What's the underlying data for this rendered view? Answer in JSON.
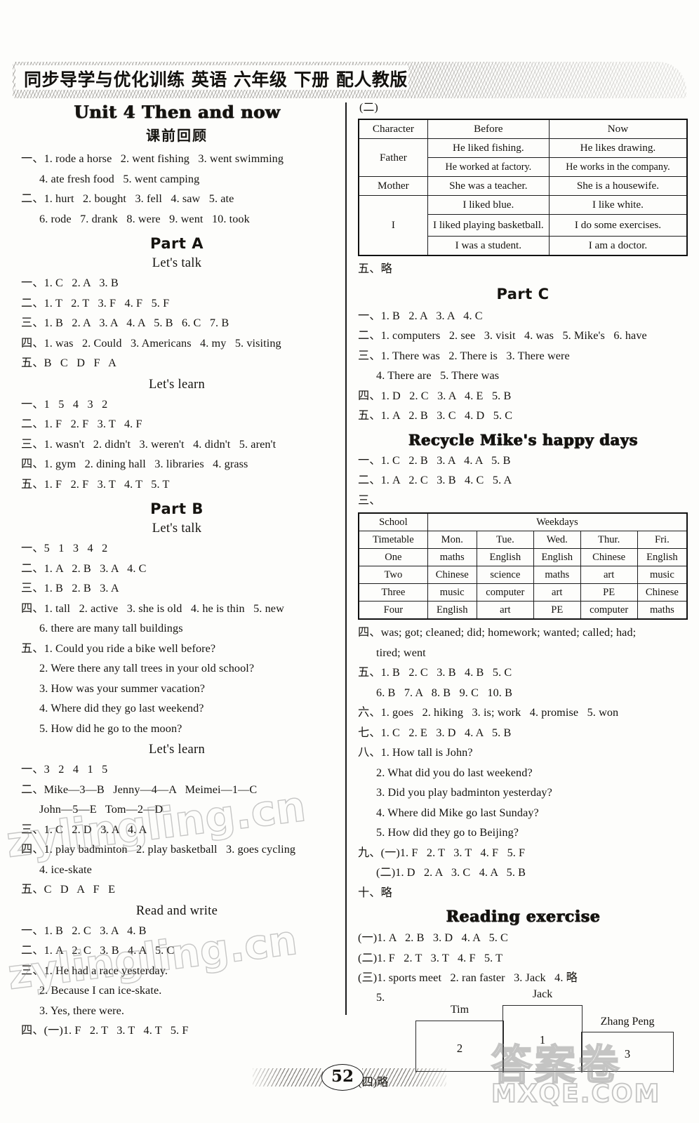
{
  "header": {
    "banner_title": "同步导学与优化训练  英语  六年级  下册  配人教版"
  },
  "left_column": {
    "unit_title": "Unit 4 Then and now",
    "pre_review_heading": "课前回顾",
    "pre_review_lines": [
      "一、1. rode a horse   2. went fishing   3. went swimming",
      "4. ate fresh food   5. went camping",
      "二、1. hurt   2. bought   3. fell   4. saw   5. ate",
      "6. rode   7. drank   8. were   9. went   10. took"
    ],
    "part_a": {
      "title": "Part A",
      "lets_talk_heading": "Let's talk",
      "lets_talk_lines": [
        "一、1. C   2. A   3. B",
        "二、1. T   2. T   3. F   4. F   5. F",
        "三、1. B   2. A   3. A   4. A   5. B   6. C   7. B",
        "四、1. was   2. Could   3. Americans   4. my   5. visiting",
        "五、B   C   D   F   A"
      ],
      "lets_learn_heading": "Let's learn",
      "lets_learn_lines": [
        "一、1   5   4   3   2",
        "二、1. F   2. F   3. T   4. F",
        "三、1. wasn't   2. didn't   3. weren't   4. didn't   5. aren't",
        "四、1. gym   2. dining hall   3. libraries   4. grass",
        "五、1. F   2. F   3. T   4. T   5. T"
      ]
    },
    "part_b": {
      "title": "Part B",
      "lets_talk_heading": "Let's talk",
      "lets_talk_lines": [
        "一、5   1   3   4   2",
        "二、1. A   2. B   3. A   4. C",
        "三、1. B   2. B   3. A",
        "四、1. tall   2. active   3. she is old   4. he is thin   5. new",
        "6. there are many tall buildings",
        "五、1. Could you ride a bike well before?",
        "2. Were there any tall trees in your old school?",
        "3. How was your summer vacation?",
        "4. Where did they go last weekend?",
        "5. How did he go to the moon?"
      ],
      "lets_learn_heading": "Let's learn",
      "lets_learn_lines": [
        "一、3   2   4   1   5",
        "二、Mike—3—B   Jenny—4—A   Meimei—1—C",
        "John—5—E   Tom—2—D",
        "三、1. C   2. D   3. A   4. A",
        "四、1. play badminton   2. play basketball   3. goes cycling",
        "4. ice-skate",
        "五、C   D   A   F   E"
      ],
      "read_and_write_heading": "Read and write",
      "read_and_write_lines": [
        "一、1. B   2. C   3. A   4. B",
        "二、1. A   2. C   3. B   4. A   5. C",
        "三、1. He had a race yesterday.",
        "2. Because I can ice-skate.",
        "3. Yes, there were.",
        "四、(一)1. F   2. T   3. T   4. T   5. F"
      ]
    }
  },
  "right_column": {
    "section_two_label": "(二)",
    "character_table": {
      "headers": [
        "Character",
        "Before",
        "Now"
      ],
      "rows": [
        {
          "character": "Father",
          "rowspan": 2,
          "cells": [
            [
              "He liked fishing.",
              "He likes drawing."
            ],
            [
              "He worked at factory.",
              "He works in the company."
            ]
          ]
        },
        {
          "character": "Mother",
          "rowspan": 1,
          "cells": [
            [
              "She was a teacher.",
              "She is a housewife."
            ]
          ]
        },
        {
          "character": "I",
          "rowspan": 3,
          "cells": [
            [
              "I liked blue.",
              "I like white."
            ],
            [
              "I liked playing basketball.",
              "I do some exercises."
            ],
            [
              "I was a student.",
              "I am a doctor."
            ]
          ]
        }
      ]
    },
    "after_table_line": "五、略",
    "part_c": {
      "title": "Part C",
      "lines": [
        "一、1. B   2. A   3. A   4. C",
        "二、1. computers   2. see   3. visit   4. was   5. Mike's   6. have",
        "三、1. There was   2. There is   3. There were",
        "4. There are   5. There was",
        "四、1. D   2. C   3. A   4. E   5. B",
        "五、1. A   2. B   3. C   4. D   5. C"
      ]
    },
    "recycle": {
      "title": "Recycle   Mike's happy days",
      "lines_before_table": [
        "一、1. C   2. B   3. A   4. A   5. B",
        "二、1. A   2. C   3. B   4. C   5. A",
        "三、"
      ],
      "timetable": {
        "corner_line1": "School",
        "corner_line2": "Timetable",
        "group_header": "Weekdays",
        "days": [
          "Mon.",
          "Tue.",
          "Wed.",
          "Thur.",
          "Fri."
        ],
        "periods": [
          "One",
          "Two",
          "Three",
          "Four"
        ],
        "rows": [
          [
            "maths",
            "English",
            "English",
            "Chinese",
            "English"
          ],
          [
            "Chinese",
            "science",
            "maths",
            "art",
            "music"
          ],
          [
            "music",
            "computer",
            "art",
            "PE",
            "Chinese"
          ],
          [
            "English",
            "art",
            "PE",
            "computer",
            "maths"
          ]
        ]
      },
      "lines_after_table": [
        "四、was; got; cleaned; did; homework; wanted; called; had;",
        "tired; went",
        "五、1. B   2. C   3. B   4. B   5. C",
        "6. B   7. A   8. B   9. C   10. B",
        "六、1. goes   2. hiking   3. is; work   4. promise   5. won",
        "七、1. C   2. E   3. D   4. A   5. B",
        "八、1. How tall is John?",
        "2. What did you do last weekend?",
        "3. Did you play badminton yesterday?",
        "4. Where did Mike go last Sunday?",
        "5. How did they go to Beijing?",
        "九、(一)1. F   2. T   3. T   4. F   5. F",
        "(二)1. D   2. A   3. C   4. A   5. B",
        "十、略"
      ]
    },
    "reading_exercise": {
      "title": "Reading exercise",
      "lines": [
        "(一)1. A   2. B   3. D   4. A   5. C",
        "(二)1. F   2. T   3. T   4. F   5. T",
        "(三)1. sports meet   2. ran faster   3. Jack   4. 略"
      ],
      "podium": {
        "item_number": "5.",
        "first_name": "Jack",
        "first_rank": "1",
        "second_name": "Tim",
        "second_rank": "2",
        "third_name": "Zhang Peng",
        "third_rank": "3"
      },
      "last_line": "(四)略"
    }
  },
  "footer": {
    "page_number": "52"
  },
  "watermarks": {
    "line_a": "zylingling.cn",
    "line_b": "zylingling.cn",
    "cn_mark": "答案卷",
    "site_mark": "MXQE.COM"
  }
}
